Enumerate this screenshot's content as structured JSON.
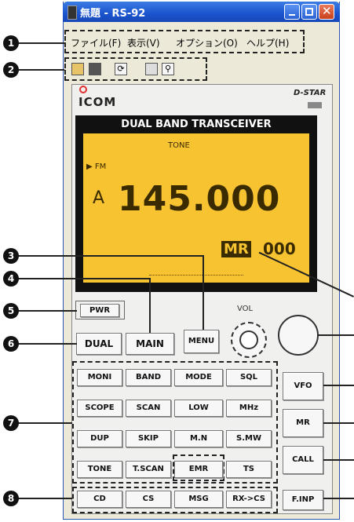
{
  "window": {
    "title": "無題 - RS-92"
  },
  "menubar": {
    "items": [
      "ファイル(F)",
      "表示(V)",
      "オプション(O)",
      "ヘルプ(H)"
    ]
  },
  "toolbar": {
    "icons": [
      "open-folder-icon",
      "save-icon",
      "refresh-icon",
      "list-icon",
      "search-icon"
    ]
  },
  "radio": {
    "logo": "ICOM",
    "dstar": "D-STAR",
    "display_title": "DUAL BAND TRANSCEIVER",
    "tone": "TONE",
    "mode": "▶ FM",
    "band": "A",
    "frequency": "145.000",
    "memory_label": "MR",
    "memory_channel": "000",
    "vol_label": "VOL",
    "pwr": "PWR",
    "dual": "DUAL",
    "main": "MAIN",
    "menu": "MENU",
    "keypad": [
      [
        "MONI",
        "BAND",
        "MODE",
        "SQL"
      ],
      [
        "SCOPE",
        "SCAN",
        "LOW",
        "MHz"
      ],
      [
        "DUP",
        "SKIP",
        "M.N",
        "S.MW"
      ],
      [
        "TONE",
        "T.SCAN",
        "EMR",
        "TS"
      ],
      [
        "CD",
        "CS",
        "MSG",
        "RX->CS"
      ]
    ],
    "side_buttons": [
      "VFO",
      "MR",
      "CALL",
      "F.INP"
    ]
  },
  "callouts": [
    "1",
    "2",
    "3",
    "4",
    "5",
    "6",
    "7",
    "8"
  ]
}
